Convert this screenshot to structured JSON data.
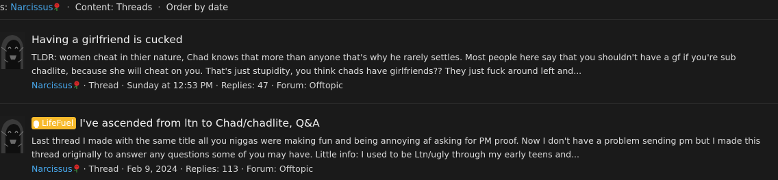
{
  "filter_bar": {
    "prefix": "s:",
    "author": "Narcissus",
    "author_badge_icon": "rose-icon",
    "content_filter": "Content: Threads",
    "order": "Order by date",
    "separator": "·"
  },
  "results": [
    {
      "title": "Having a girlfriend is cucked",
      "prefix_label": "",
      "snippet": "TLDR: women cheat in thier nature, Chad knows that more than anyone that's why he rarely settles. Most people here say that you shouldn't have a gf if you're sub chadlite, because she will cheat on you. That's just stupidity, you think chads have girlfriends?? They just fuck around left and...",
      "author": "Narcissus",
      "type": "Thread",
      "date": "Sunday at 12:53 PM",
      "replies": "Replies: 47",
      "forum": "Forum: Offtopic"
    },
    {
      "title": "I've ascended from ltn to Chad/chadlite, Q&A",
      "prefix_label": "LifeFuel",
      "snippet": "Last thread I made with the same title all you niggas were making fun and being annoying af asking for PM proof. Now I don't have a problem sending pm but I made this thread originally to answer any questions some of you may have. Little info: I used to be Ltn/ugly through my early teens and...",
      "author": "Narcissus",
      "type": "Thread",
      "date": "Feb 9, 2024",
      "replies": "Replies: 113",
      "forum": "Forum: Offtopic"
    }
  ],
  "colors": {
    "background": "#1a1a1a",
    "link": "#47a7eb",
    "label_lifefuel": "#f7ba2c",
    "divider": "#2c2c2c"
  }
}
